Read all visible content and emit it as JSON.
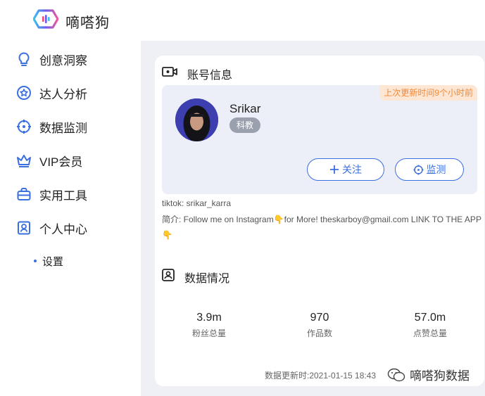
{
  "app": {
    "name": "嘀嗒狗"
  },
  "sidebar": {
    "items": [
      {
        "label": "创意洞察",
        "icon": "bulb-icon"
      },
      {
        "label": "达人分析",
        "icon": "star-badge-icon"
      },
      {
        "label": "数据监测",
        "icon": "target-icon"
      },
      {
        "label": "VIP会员",
        "icon": "crown-icon"
      },
      {
        "label": "实用工具",
        "icon": "toolbox-icon"
      },
      {
        "label": "个人中心",
        "icon": "user-card-icon"
      }
    ],
    "sub_items": [
      {
        "label": "设置"
      }
    ]
  },
  "account": {
    "title": "账号信息",
    "update_badge": "上次更新时间9个小时前",
    "name": "Srikar",
    "category": "科教",
    "follow_label": "关注",
    "monitor_label": "监测",
    "handle": "tiktok: srikar_karra",
    "bio": "简介: Follow me on Instagram👇for More! theskarboy@gmail.com LINK TO THE APP 👇"
  },
  "data_section": {
    "title": "数据情况",
    "stats": [
      {
        "value": "3.9m",
        "label": "粉丝总量"
      },
      {
        "value": "970",
        "label": "作品数"
      },
      {
        "value": "57.0m",
        "label": "点赞总量"
      }
    ],
    "updated": "数据更新时:2021-01-15 18:43"
  },
  "watermark": {
    "text": "嘀嗒狗数据"
  },
  "colors": {
    "accent": "#3a6fe0",
    "badge_bg": "#fde6d3",
    "badge_text": "#f08a3c",
    "tag_bg": "#9aa0ad"
  }
}
